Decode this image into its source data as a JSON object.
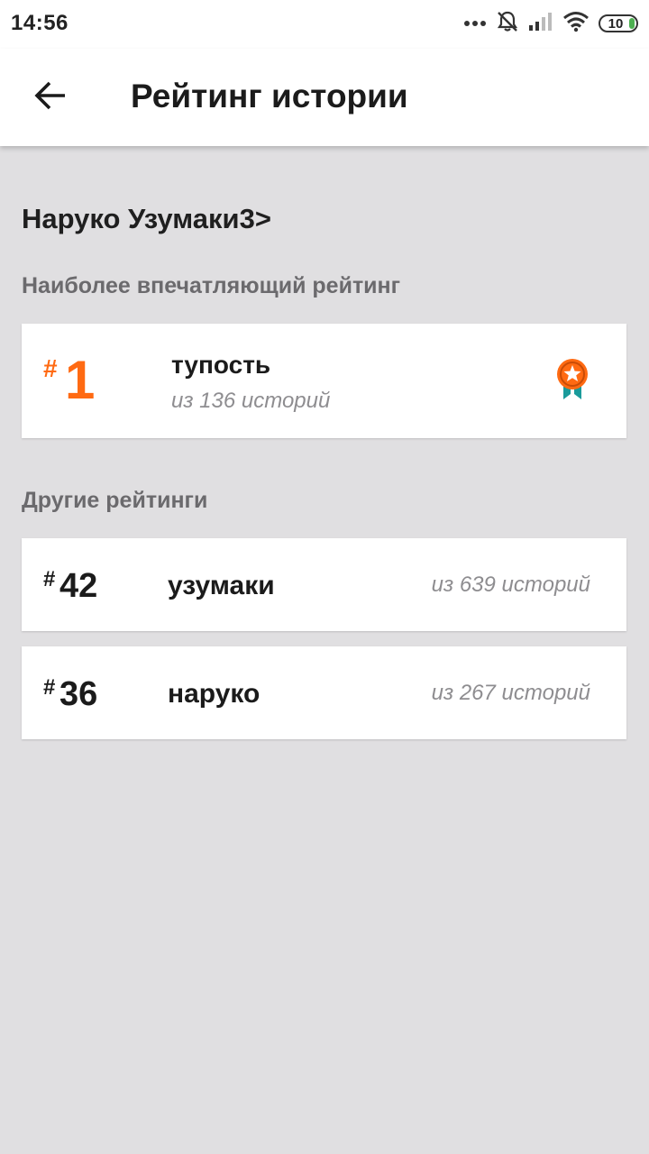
{
  "status_bar": {
    "time": "14:56",
    "battery": "10",
    "icons": [
      "more-dots-icon",
      "notifications-off-icon",
      "signal-icon",
      "wifi-icon",
      "battery-icon"
    ]
  },
  "app_bar": {
    "title": "Рейтинг истории",
    "back_icon": "arrow-left-icon"
  },
  "character_name": "Наруко Узумаки3>",
  "top_section": {
    "title": "Наиболее впечатляющий рейтинг",
    "item": {
      "hash": "#",
      "rank": "1",
      "tag": "тупость",
      "count": "из 136 историй",
      "badge_icon": "award-ribbon-icon"
    }
  },
  "other_section": {
    "title": "Другие рейтинги",
    "items": [
      {
        "hash": "#",
        "rank": "42",
        "tag": "узумаки",
        "count": "из 639 историй"
      },
      {
        "hash": "#",
        "rank": "36",
        "tag": "наруко",
        "count": "из 267 историй"
      }
    ]
  },
  "colors": {
    "accent": "#ff6a12",
    "background": "#e0dfe1",
    "badge_ribbon": "#1a9b9b"
  }
}
